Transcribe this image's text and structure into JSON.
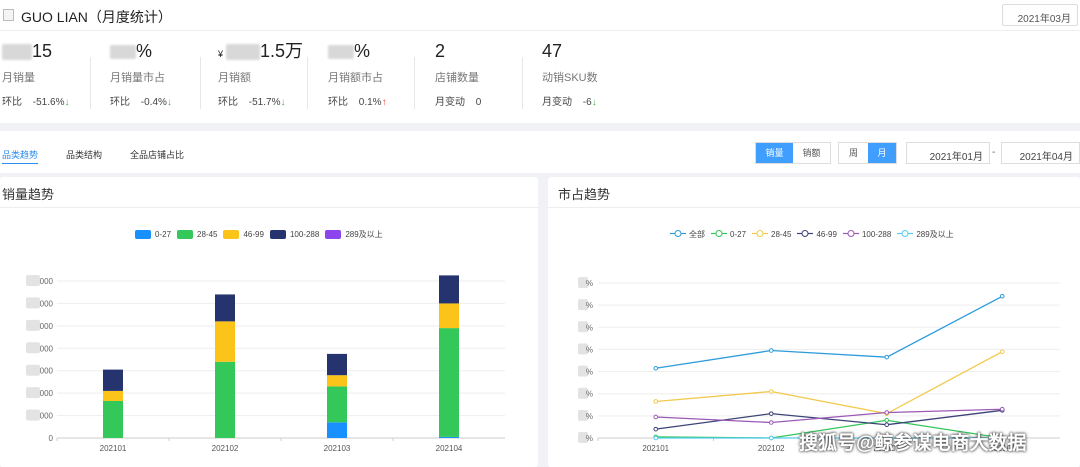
{
  "header": {
    "title": "GUO LIAN（月度统计）",
    "month": "2021年03月",
    "logo_icon": "document-icon"
  },
  "stats": [
    {
      "value_suffix": "15",
      "label": "月销量",
      "change_label": "环比",
      "change": "-51.6%",
      "direction": "down"
    },
    {
      "value_suffix": "%",
      "label": "月销量市占",
      "change_label": "环比",
      "change": "-0.4%",
      "direction": "down"
    },
    {
      "value_prefix": "¥",
      "value_suffix": "1.5万",
      "label": "月销额",
      "change_label": "环比",
      "change": "-51.7%",
      "direction": "down"
    },
    {
      "value_suffix": "%",
      "label": "月销额市占",
      "change_label": "环比",
      "change": "0.1%",
      "direction": "up"
    },
    {
      "value": "2",
      "label": "店铺数量",
      "change_label": "月变动",
      "change": "0"
    },
    {
      "value": "47",
      "label": "动销SKU数",
      "change_label": "月变动",
      "change": "-6",
      "direction": "down"
    }
  ],
  "tabs": [
    "品类趋势",
    "品类结构",
    "全品店铺占比"
  ],
  "metric_toggle": [
    "销量",
    "销额"
  ],
  "period_toggle": [
    "周",
    "月"
  ],
  "date_range": {
    "start": "2021年01月",
    "separator": "-",
    "end": "2021年04月"
  },
  "left_panel": {
    "title": "销量趋势"
  },
  "right_panel": {
    "title": "市占趋势"
  },
  "colors": {
    "accent": "#409eff",
    "up": "#f44336",
    "down": "#4caf50"
  },
  "chart_data": [
    {
      "type": "bar",
      "stacked": true,
      "categories": [
        "202101",
        "202102",
        "202103",
        "202104"
      ],
      "series": [
        {
          "name": "0-27",
          "color": "#1890ff",
          "values": [
            0,
            0,
            700,
            50
          ]
        },
        {
          "name": "28-45",
          "color": "#34c759",
          "values": [
            1650,
            3400,
            1600,
            4850
          ]
        },
        {
          "name": "46-99",
          "color": "#fcc419",
          "values": [
            450,
            1800,
            500,
            1100
          ]
        },
        {
          "name": "100-288",
          "color": "#25336e",
          "values": [
            950,
            1200,
            950,
            1250
          ]
        },
        {
          "name": "289及以上",
          "color": "#8e44ec",
          "values": [
            0,
            0,
            0,
            0
          ]
        }
      ],
      "ylim": [
        0,
        7000
      ],
      "yticks_visible": [
        "0",
        "000",
        "000",
        "000",
        "000",
        "000",
        "000",
        "000"
      ],
      "grid": true,
      "legend": "top"
    },
    {
      "type": "line",
      "categories": [
        "202101",
        "202102",
        "202103",
        "202104"
      ],
      "series": [
        {
          "name": "全部",
          "color": "#2d9cdb",
          "values": [
            63,
            79,
            73,
            128
          ]
        },
        {
          "name": "0-27",
          "color": "#34c759",
          "values": [
            1,
            0,
            16,
            0
          ]
        },
        {
          "name": "28-45",
          "color": "#f2c94c",
          "values": [
            33,
            42,
            22,
            78
          ]
        },
        {
          "name": "46-99",
          "color": "#3c4377",
          "values": [
            8,
            22,
            12,
            25
          ]
        },
        {
          "name": "100-288",
          "color": "#9b59b6",
          "values": [
            19,
            14,
            23,
            26
          ]
        },
        {
          "name": "289及以上",
          "color": "#56ccf2",
          "values": [
            0,
            0,
            0,
            0
          ]
        }
      ],
      "ylim": [
        0,
        140
      ],
      "tick_suffix": "%",
      "grid": true,
      "legend": "top"
    }
  ],
  "watermark": "搜狐号@鲸参谋电商大数据"
}
